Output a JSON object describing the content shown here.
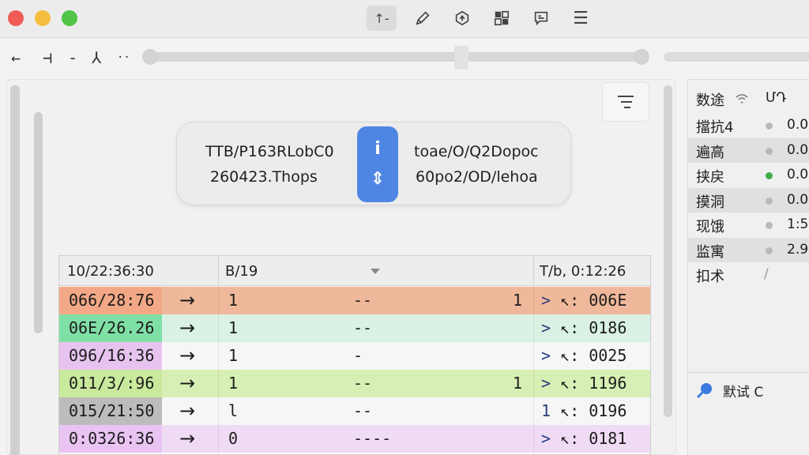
{
  "toolbar": {
    "buttons": [
      {
        "name": "upload-icon",
        "glyph": "↑-"
      },
      {
        "name": "pen-icon",
        "glyph": ""
      },
      {
        "name": "sync-icon",
        "glyph": ""
      },
      {
        "name": "layout-icon",
        "glyph": ""
      },
      {
        "name": "comment-icon",
        "glyph": ""
      },
      {
        "name": "menu-icon",
        "glyph": "☰"
      }
    ]
  },
  "nav": {
    "back": "←",
    "step_a": "⊣",
    "step_b": "-",
    "step_c": "⅄",
    "more": "··"
  },
  "scrubber": {
    "value": 0.0
  },
  "info_card": {
    "left_line1": "TTB/P163RLobC0",
    "left_line2": "260423.Thops",
    "badge_top": "i",
    "badge_bottom": "⇕",
    "right_line1": "toae/O/Q2Dopoc",
    "right_line2": "60po2/OD/lehoa"
  },
  "table": {
    "headers": [
      "10/22:36:30",
      "B/19",
      "T/b, 0:12:26"
    ],
    "rows": [
      {
        "time": "066/28:76",
        "arrow": "→",
        "n": "1",
        "dash": "--",
        "flag": "1",
        "code_prefix": ">",
        "code": "↖: 006E",
        "bg": "#f0b89a",
        "time_bg": "#f2a886"
      },
      {
        "time": "06E/26.26",
        "arrow": "→",
        "n": "1",
        "dash": "--",
        "flag": "",
        "code_prefix": ">",
        "code": "↖: 0186",
        "bg": "#d9f2e3",
        "time_bg": "#7fe0a6"
      },
      {
        "time": "096/16:36",
        "arrow": "→",
        "n": "1",
        "dash": "-",
        "flag": "",
        "code_prefix": ">",
        "code": "↖: 0025",
        "bg": "#f6f6f6",
        "time_bg": "#e6c4ef"
      },
      {
        "time": "011/3/:96",
        "arrow": "→",
        "n": "1",
        "dash": "--",
        "flag": "1",
        "code_prefix": ">",
        "code": "↖: 1196",
        "bg": "#d7efb4",
        "time_bg": "#c9e99d"
      },
      {
        "time": "015/21:50",
        "arrow": "→",
        "n": "l",
        "dash": "--",
        "flag": "",
        "code_prefix": "1",
        "code": "↖: 0196",
        "bg": "#f6f6f6",
        "time_bg": "#bcbcbc"
      },
      {
        "time": "0:0326:36",
        "arrow": "→",
        "n": "0",
        "dash": "----",
        "flag": "",
        "code_prefix": ">",
        "code": "↖: 0181",
        "bg": "#f0dbf5",
        "time_bg": "#e9c4f2"
      }
    ]
  },
  "side_panel": {
    "header_label": "数途",
    "header_value": "ՄԴ",
    "items": [
      {
        "label": "擋抗4",
        "value": "0.0",
        "dot": "#b9b9b9",
        "highlight": false
      },
      {
        "label": "遍高",
        "value": "0.0",
        "dot": "#b9b9b9",
        "highlight": true
      },
      {
        "label": "挟戻",
        "value": "0.0",
        "dot": "#3fae4a",
        "highlight": false
      },
      {
        "label": "摸洞",
        "value": "0.0",
        "dot": "#b9b9b9",
        "highlight": true
      },
      {
        "label": "现饿",
        "value": "1:5",
        "dot": "#b9b9b9",
        "highlight": false
      },
      {
        "label": "监寓",
        "value": "2.9",
        "dot": "#b9b9b9",
        "highlight": true
      },
      {
        "label": "扣术",
        "value": "/",
        "dot": "",
        "highlight": false
      }
    ],
    "action_label": "默试 C"
  }
}
